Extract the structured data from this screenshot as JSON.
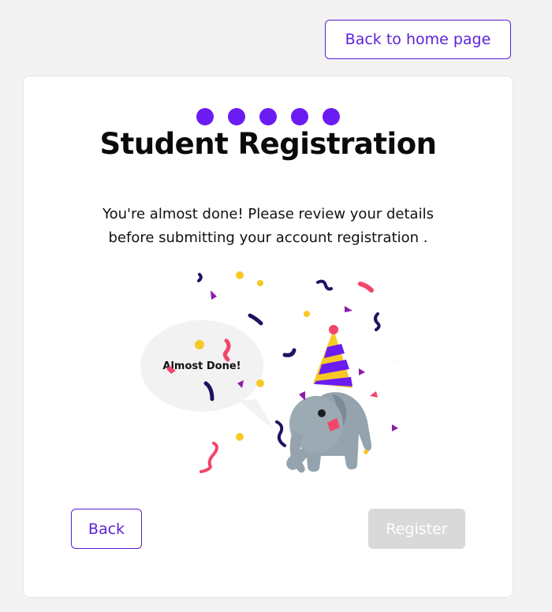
{
  "header": {
    "home_button_label": "Back to home page"
  },
  "registration": {
    "step_count": 5,
    "title": "Student Registration",
    "subtitle": "You're almost done! Please review your details before submitting your account registration .",
    "illustration": {
      "bubble_text": "Almost Done!",
      "icon": "party-elephant-icon"
    },
    "back_label": "Back",
    "register_label": "Register",
    "register_disabled": true
  },
  "colors": {
    "accent": "#6a1cf2",
    "button_border": "#5b1fd8",
    "disabled_button": "#d9d9d9",
    "background": "#f3f3f3",
    "confetti_pink": "#f2456a",
    "confetti_yellow": "#f7c925",
    "confetti_navy": "#1b1464",
    "confetti_purple": "#8e1aa8",
    "elephant_gray": "#94a3ad"
  }
}
